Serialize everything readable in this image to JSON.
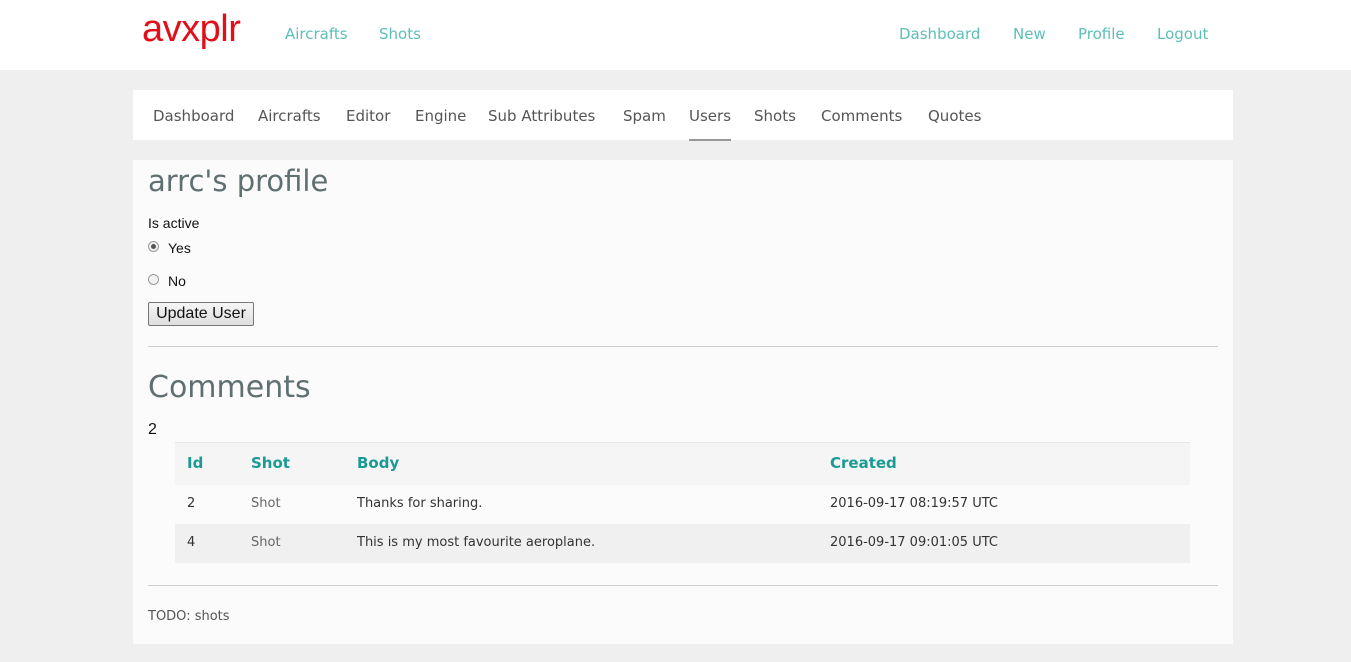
{
  "header": {
    "brand": "avxplr",
    "left_links": [
      "Aircrafts",
      "Shots"
    ],
    "right_links": [
      "Dashboard",
      "New",
      "Profile",
      "Logout"
    ],
    "brand_color": "#e0101a",
    "link_color": "#5cbfb6"
  },
  "subnav": {
    "items": [
      "Dashboard",
      "Aircrafts",
      "Editor",
      "Engine",
      "Sub Attributes",
      "Spam",
      "Users",
      "Shots",
      "Comments",
      "Quotes"
    ],
    "active": "Users"
  },
  "profile": {
    "title": "arrc's profile",
    "field_label": "Is active",
    "options": [
      "Yes",
      "No"
    ],
    "selected": "Yes",
    "submit_label": "Update User"
  },
  "comments": {
    "heading": "Comments",
    "count": "2",
    "columns": [
      "Id",
      "Shot",
      "Body",
      "Created"
    ],
    "rows": [
      {
        "id": "2",
        "shot": "Shot",
        "body": "Thanks for sharing.",
        "created": "2016-09-17 08:19:57 UTC"
      },
      {
        "id": "4",
        "shot": "Shot",
        "body": "This is my most favourite aeroplane.",
        "created": "2016-09-17 09:01:05 UTC"
      }
    ],
    "header_color": "#1a9a95"
  },
  "footer_note": "TODO: shots"
}
